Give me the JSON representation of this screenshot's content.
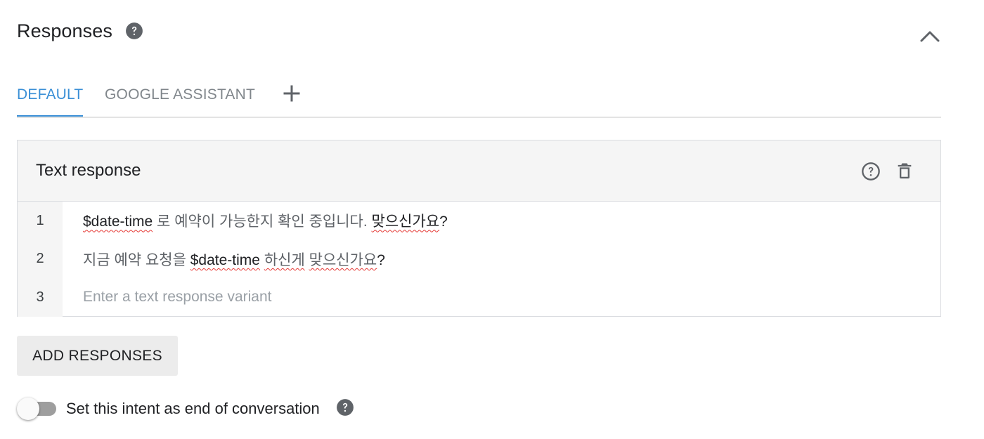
{
  "section": {
    "title": "Responses"
  },
  "tabs": [
    {
      "label": "DEFAULT",
      "active": true
    },
    {
      "label": "GOOGLE ASSISTANT",
      "active": false
    }
  ],
  "card": {
    "title": "Text response",
    "rows": [
      {
        "num": "1",
        "entity": "$date-time",
        "text_a": " 로 예약이 가능한지 확인 중입니다. ",
        "spell_a": "맞으신가요",
        "tail": "?"
      },
      {
        "num": "2",
        "prefix": "지금 예약 요청을 ",
        "entity": "$date-time",
        "space": " ",
        "spell_a": "하신게",
        "space2": " ",
        "spell_b": "맞으신가요",
        "tail": "?"
      },
      {
        "num": "3",
        "placeholder": "Enter a text response variant"
      }
    ]
  },
  "add_button_label": "ADD RESPONSES",
  "end_conversation": {
    "label": "Set this intent as end of conversation",
    "enabled": false
  },
  "colors": {
    "accent": "#3a8fd6",
    "muted_text": "#80868b",
    "icon": "#5f6368"
  },
  "icons": {
    "title_help": "help-filled-icon",
    "collapse": "chevron-up-icon",
    "add_tab": "plus-icon",
    "card_help": "help-outline-icon",
    "delete": "trash-icon",
    "end_help": "help-filled-icon"
  }
}
